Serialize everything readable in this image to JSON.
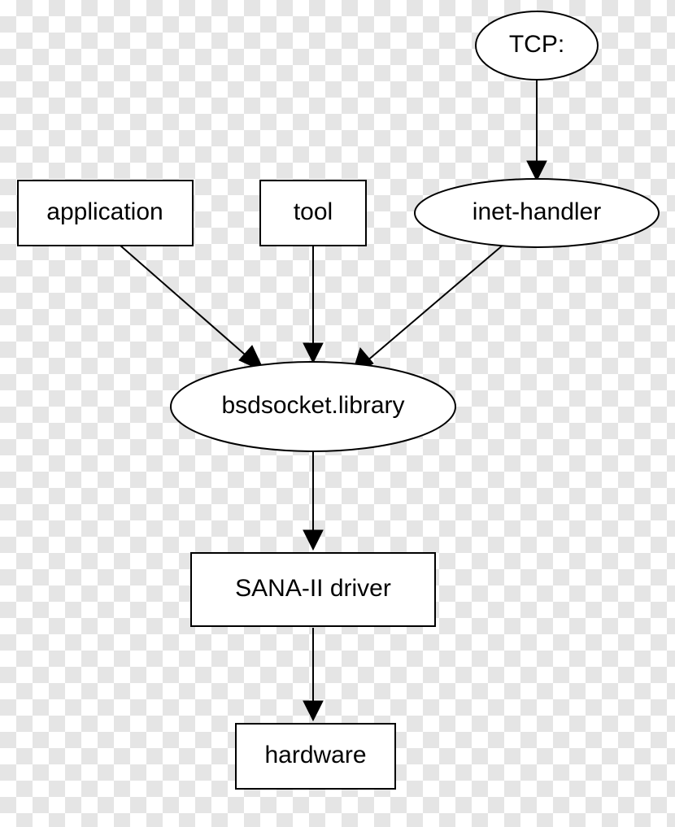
{
  "nodes": {
    "tcp": {
      "label": "TCP:"
    },
    "application": {
      "label": "application"
    },
    "tool": {
      "label": "tool"
    },
    "inet": {
      "label": "inet-handler"
    },
    "bsdsocket": {
      "label": "bsdsocket.library"
    },
    "sana": {
      "label": "SANA-II driver"
    },
    "hardware": {
      "label": "hardware"
    }
  },
  "edges": [
    [
      "tcp",
      "inet"
    ],
    [
      "application",
      "bsdsocket"
    ],
    [
      "tool",
      "bsdsocket"
    ],
    [
      "inet",
      "bsdsocket"
    ],
    [
      "bsdsocket",
      "sana"
    ],
    [
      "sana",
      "hardware"
    ]
  ]
}
